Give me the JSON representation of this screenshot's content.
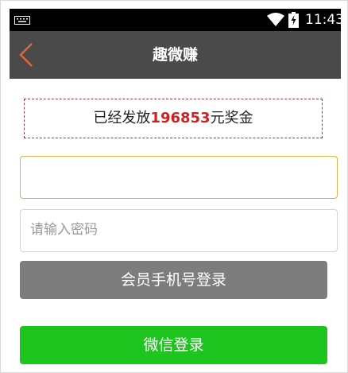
{
  "status_bar": {
    "time": "11:43",
    "icons": [
      "keyboard-icon",
      "wifi-icon",
      "battery-charging-icon"
    ]
  },
  "nav": {
    "title": "趣微赚",
    "back_icon": "chevron-left-icon",
    "back_color": "#e8633a"
  },
  "bonus": {
    "prefix": "已经发放",
    "amount": "196853",
    "suffix": "元奖金"
  },
  "form": {
    "phone_value": "",
    "password_placeholder": "请输入密码"
  },
  "buttons": {
    "phone_login": "会员手机号登录",
    "wechat_login": "微信登录"
  },
  "colors": {
    "nav_bg": "#4a4a4a",
    "bonus_amount": "#cc2222",
    "phone_login_bg": "#7d7d7d",
    "wechat_login_bg": "#1fc51f"
  }
}
